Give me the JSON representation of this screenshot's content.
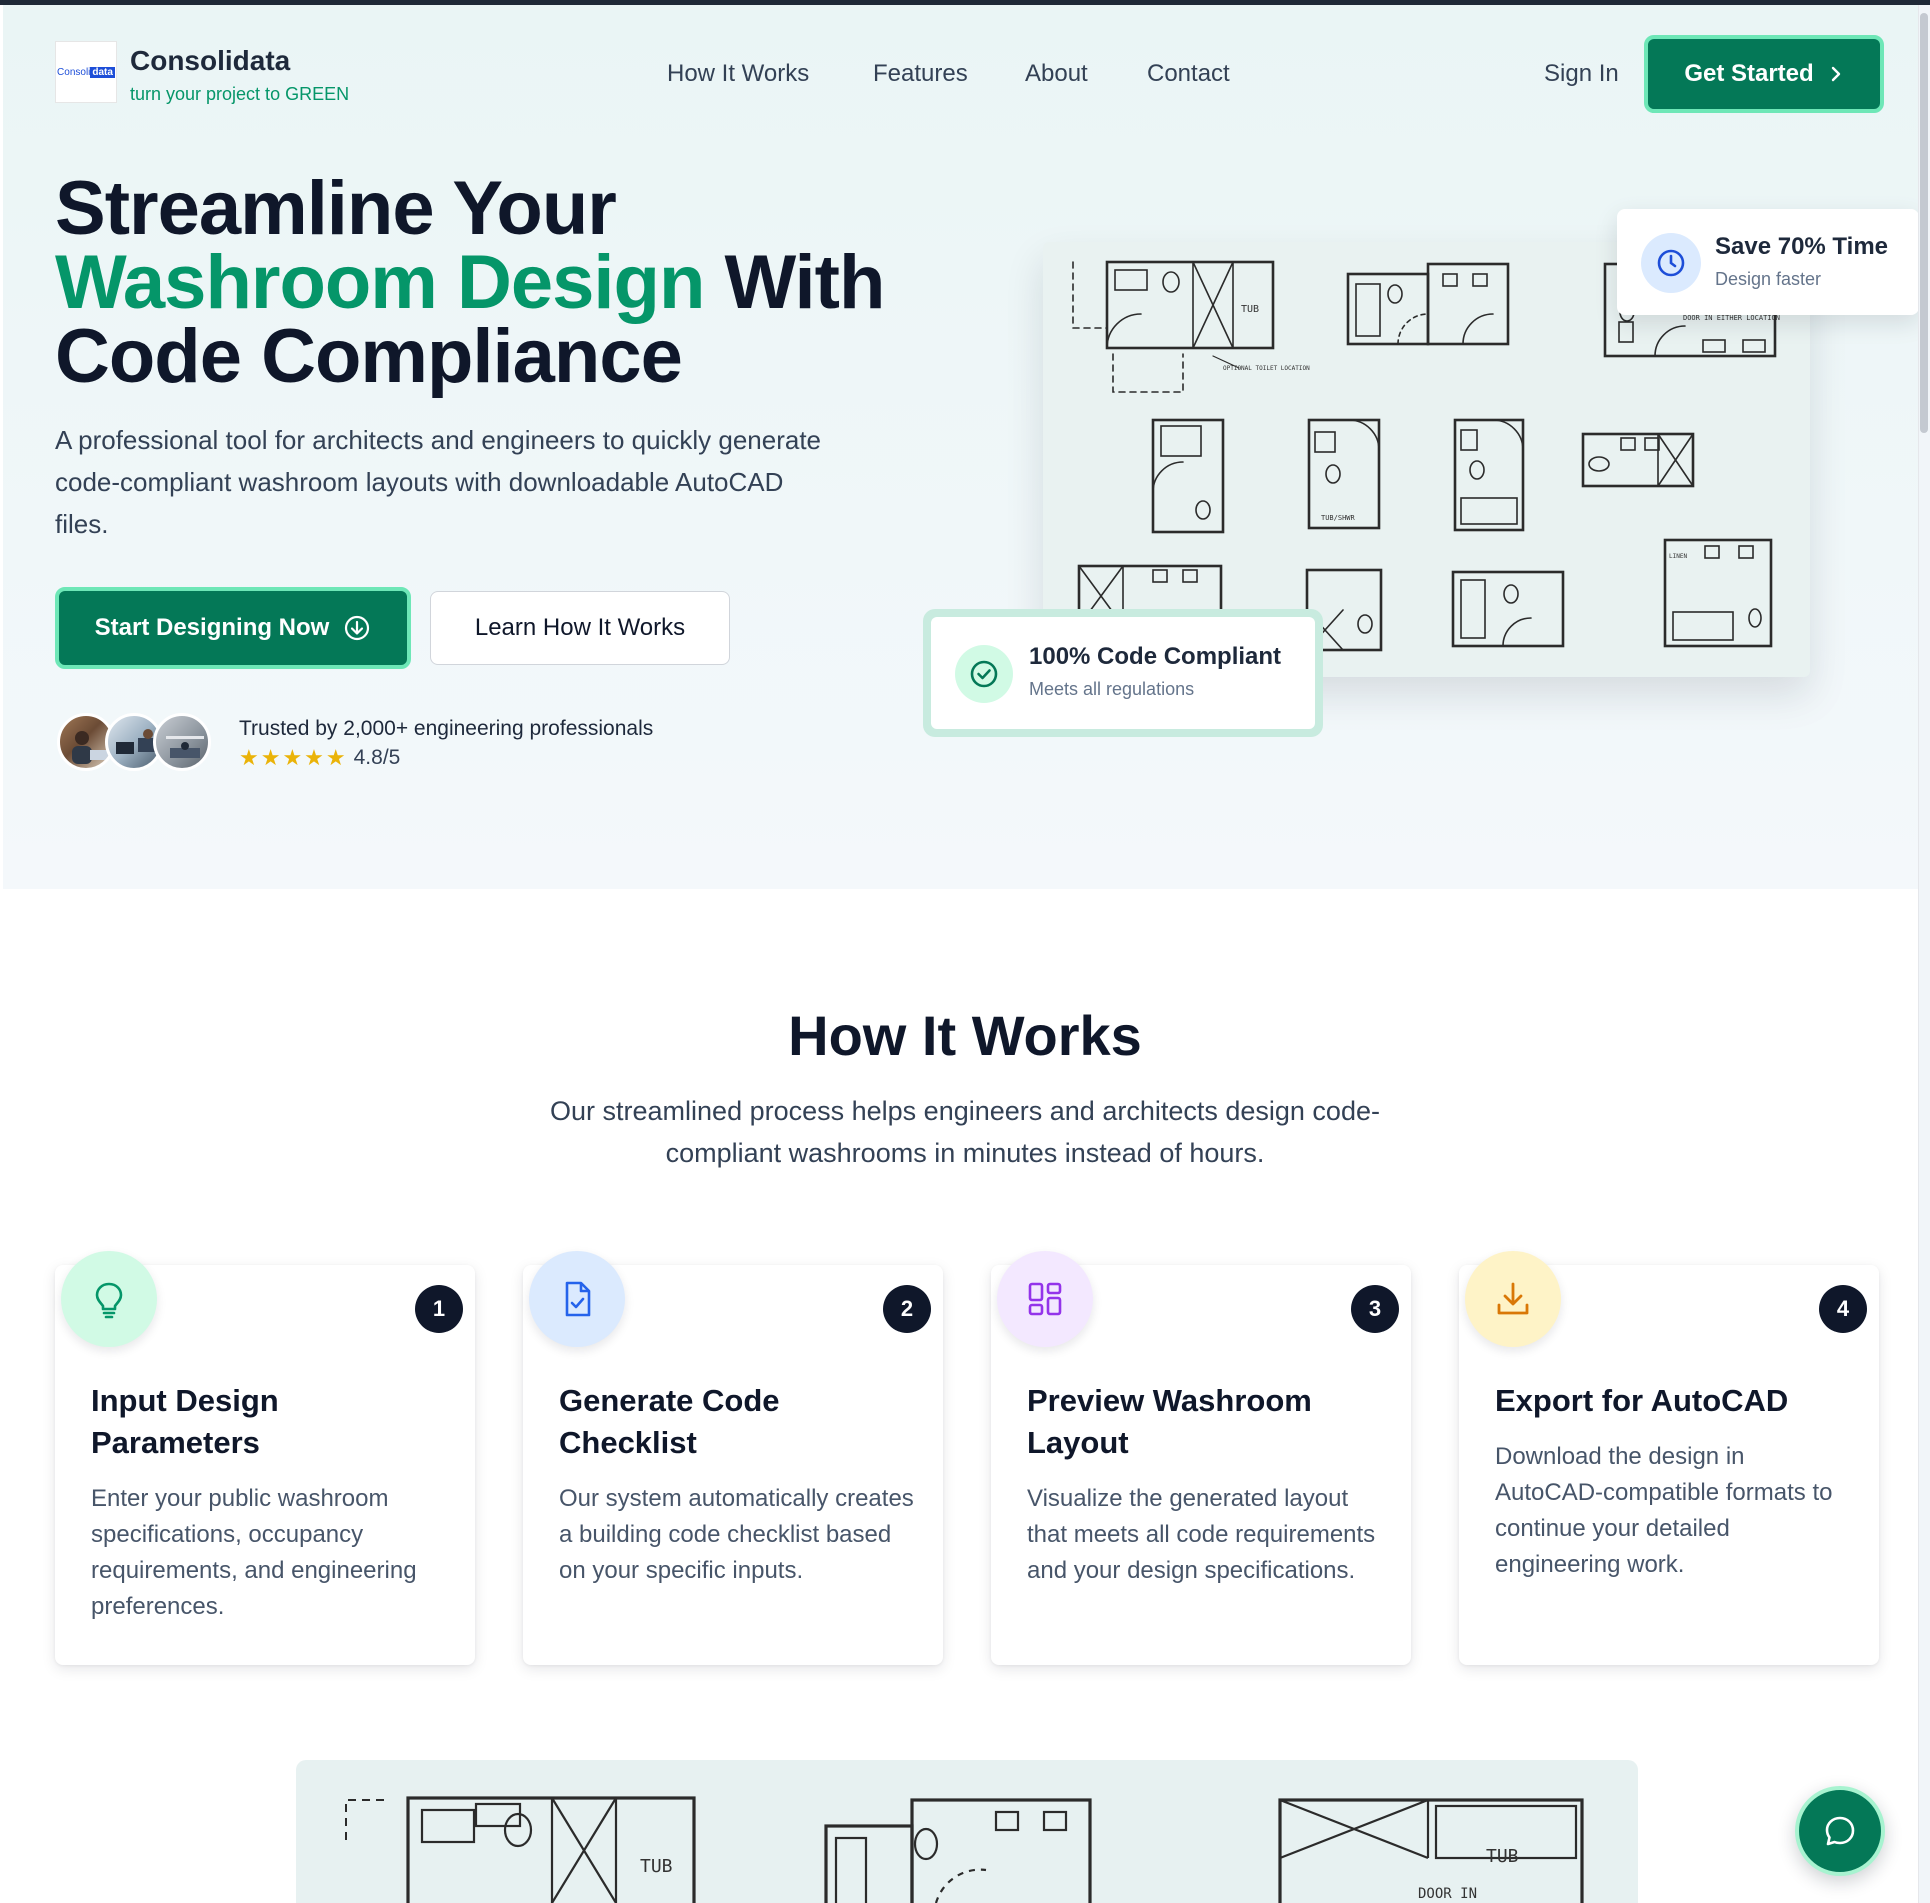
{
  "brand": {
    "logo_text_a": "Consoli",
    "logo_text_b": "data",
    "name": "Consolidata",
    "tagline": "turn your project to GREEN"
  },
  "nav": {
    "links": [
      "How It Works",
      "Features",
      "About",
      "Contact"
    ],
    "sign_in": "Sign In",
    "get_started": "Get Started"
  },
  "hero": {
    "headline_line1": "Streamline Your",
    "headline_green": "Washroom Design",
    "headline_with": " With",
    "headline_line3": "Code Compliance",
    "subtext": "A professional tool for architects and engineers to quickly generate code-compliant washroom layouts with downloadable AutoCAD files.",
    "primary_cta": "Start Designing Now",
    "secondary_cta": "Learn How It Works",
    "trusted_text": "Trusted by 2,000+ engineering professionals",
    "rating_value": "4.8/5",
    "stars": "★★★★★",
    "float_time_title": "Save 70% Time",
    "float_time_sub": "Design faster",
    "float_code_title": "100% Code Compliant",
    "float_code_sub": "Meets all regulations"
  },
  "how_it_works": {
    "title": "How It Works",
    "subtitle": "Our streamlined process helps engineers and architects design code-compliant washrooms in minutes instead of hours.",
    "steps": [
      {
        "number": "1",
        "title": "Input Design Parameters",
        "description": "Enter your public washroom specifications, occupancy requirements, and engineering preferences.",
        "icon": "lightbulb-icon",
        "color": "#d1fae5"
      },
      {
        "number": "2",
        "title": "Generate Code Checklist",
        "description": "Our system automatically creates a building code checklist based on your specific inputs.",
        "icon": "file-check-icon",
        "color": "#dbeafe"
      },
      {
        "number": "3",
        "title": "Preview Washroom Layout",
        "description": "Visualize the generated layout that meets all code requirements and your design specifications.",
        "icon": "layout-grid-icon",
        "color": "#f3e8ff"
      },
      {
        "number": "4",
        "title": "Export for AutoCAD",
        "description": "Download the design in AutoCAD-compatible formats to continue your detailed engineering work.",
        "icon": "download-icon",
        "color": "#fef3c7"
      }
    ]
  },
  "plan_labels": {
    "tub": "TUB",
    "tub_shwr": "TUB/SHWR",
    "optional_toilet": "OPTIONAL TOILET LOCATION",
    "door": "DOOR IN EITHER LOCATION",
    "linen": "LINEN",
    "door_short": "DOOR IN"
  },
  "colors": {
    "brand_green": "#047857",
    "accent_green": "#059669",
    "navy": "#0f172a",
    "star": "#eab308"
  }
}
